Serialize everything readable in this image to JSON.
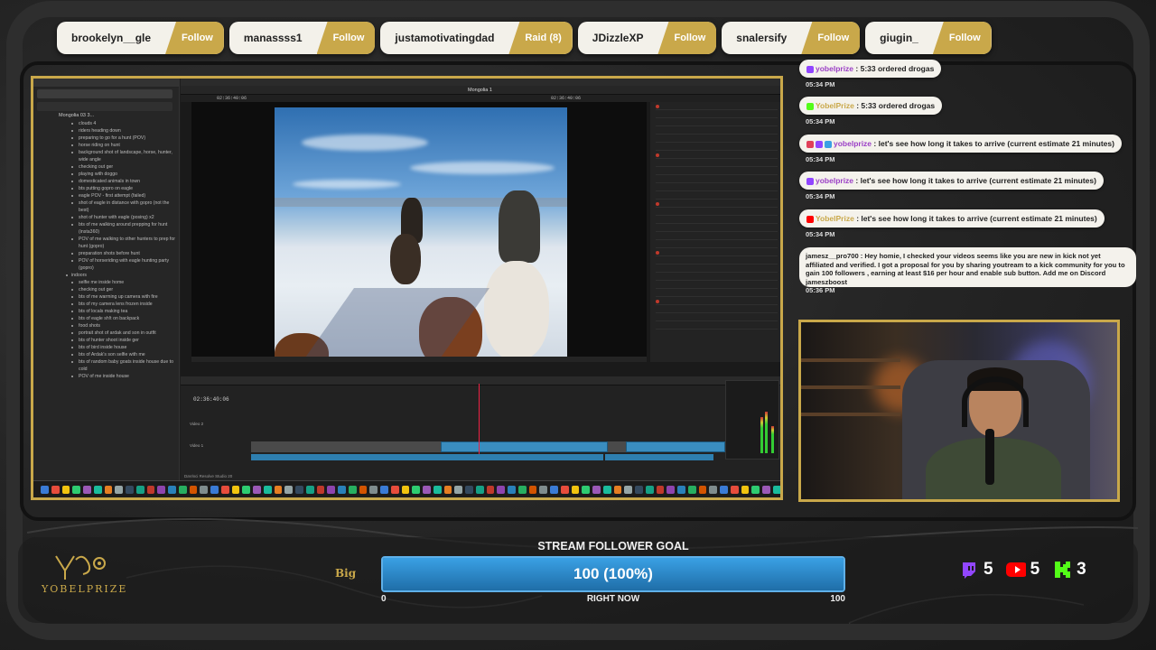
{
  "pills": [
    {
      "name": "brookelyn__gle",
      "action": "Follow"
    },
    {
      "name": "manassss1",
      "action": "Follow"
    },
    {
      "name": "justamotivatingdad",
      "action": "Raid (8)"
    },
    {
      "name": "JDizzleXP",
      "action": "Follow"
    },
    {
      "name": "snalersify",
      "action": "Follow"
    },
    {
      "name": "giugin_",
      "action": "Follow"
    }
  ],
  "screen": {
    "notes_title": "Mongolia 03 3...",
    "notes": [
      {
        "t": "clouds 4",
        "head": false
      },
      {
        "t": "riders heading down",
        "head": false
      },
      {
        "t": "preparing to go for a hunt (POV)",
        "head": false
      },
      {
        "t": "horse riding on hunt",
        "head": false
      },
      {
        "t": "background shot of landscape, horse, hunter, wide angle",
        "head": false
      },
      {
        "t": "checking out ger",
        "head": false
      },
      {
        "t": "playing with doggo",
        "head": false
      },
      {
        "t": "domesticated animals in town",
        "head": false
      },
      {
        "t": "bts putting gopro on eagle",
        "head": false
      },
      {
        "t": "eagle POV - first attempt (failed)",
        "head": false
      },
      {
        "t": "shot of eagle in distance with gopro (not the best)",
        "head": false
      },
      {
        "t": "shot of hunter with eagle (posing) x2",
        "head": false
      },
      {
        "t": "bts of me walking around prepping for hunt (insta360)",
        "head": false
      },
      {
        "t": "POV of me walking to other hunters to prep for hunt (gopro)",
        "head": false
      },
      {
        "t": "preparation shots before hunt",
        "head": false
      },
      {
        "t": "POV of horseriding with eagle hunting party (gopro)",
        "head": false
      },
      {
        "t": "indoors",
        "head": true
      },
      {
        "t": "selfie me inside home",
        "head": false
      },
      {
        "t": "checking out ger",
        "head": false
      },
      {
        "t": "bts of me warming up camera with fire",
        "head": false
      },
      {
        "t": "bts of my camera lens frozen inside",
        "head": false
      },
      {
        "t": "bts of locals making tea",
        "head": false
      },
      {
        "t": "bts of eagle sh!t on backpack",
        "head": false
      },
      {
        "t": "food shots",
        "head": false
      },
      {
        "t": "portrait shot of ardak and son in outfit",
        "head": false
      },
      {
        "t": "bts of hunter shoot inside ger",
        "head": false
      },
      {
        "t": "bts of bird inside house",
        "head": false
      },
      {
        "t": "bts of Ardak's son selfie with me",
        "head": false
      },
      {
        "t": "bts of random baby goats inside house due to cold",
        "head": false
      },
      {
        "t": "POV of me inside house",
        "head": false
      }
    ],
    "project_name": "Mongolia 1",
    "timecode": "02:36:40:06",
    "viewer_tc": "02:36:40:06",
    "app_name": "DaVinci Resolve Studio 20",
    "track_v2": "Video 2",
    "track_v1": "Video 1"
  },
  "chat": [
    {
      "user": "yobelprize",
      "text": " : 5:33 ordered drogas",
      "time": "05:34 PM",
      "color": "purple"
    },
    {
      "user": "YobelPrize",
      "text": " : 5:33 ordered drogas",
      "time": "05:34 PM",
      "color": "gold"
    },
    {
      "user": "yobelprize",
      "text": " : let's see how long it takes to arrive (current estimate 21 minutes)",
      "time": "05:34 PM",
      "color": "purple"
    },
    {
      "user": "yobelprize",
      "text": " : let's see how long it takes to arrive (current estimate 21 minutes)",
      "time": "05:34 PM",
      "color": "purple"
    },
    {
      "user": "YobelPrize",
      "text": " : let's see how long it takes to arrive (current estimate 21 minutes)",
      "time": "05:34 PM",
      "color": "gold"
    }
  ],
  "chat_long": {
    "user": "jamesz__pro700",
    "text": " : Hey homie, I checked your videos seems like you are new in kick not yet affiliated and verified. I got a proposal for you by sharing youtream to a kick community for you to gain 100 followers , earning at least $16 per hour and enable sub button. Add me on Discord jameszboost",
    "time": "05:36 PM"
  },
  "branding": {
    "logo_text": "YOBELPRIZE",
    "big_label": "Big"
  },
  "goal": {
    "title": "STREAM FOLLOWER GOAL",
    "value_text": "100 (100%)",
    "progress": 1.0,
    "min": "0",
    "max": "100",
    "subtitle": "RIGHT NOW"
  },
  "platforms": [
    {
      "name": "twitch",
      "count": "5",
      "color": "#9146ff"
    },
    {
      "name": "youtube",
      "count": "5",
      "color": "#ff0000"
    },
    {
      "name": "kick",
      "count": "3",
      "color": "#53fc18"
    }
  ],
  "colors": {
    "gold": "#c9a84a",
    "pill_bg": "#f3f1ea",
    "goal_blue": "#3aa0e4"
  }
}
